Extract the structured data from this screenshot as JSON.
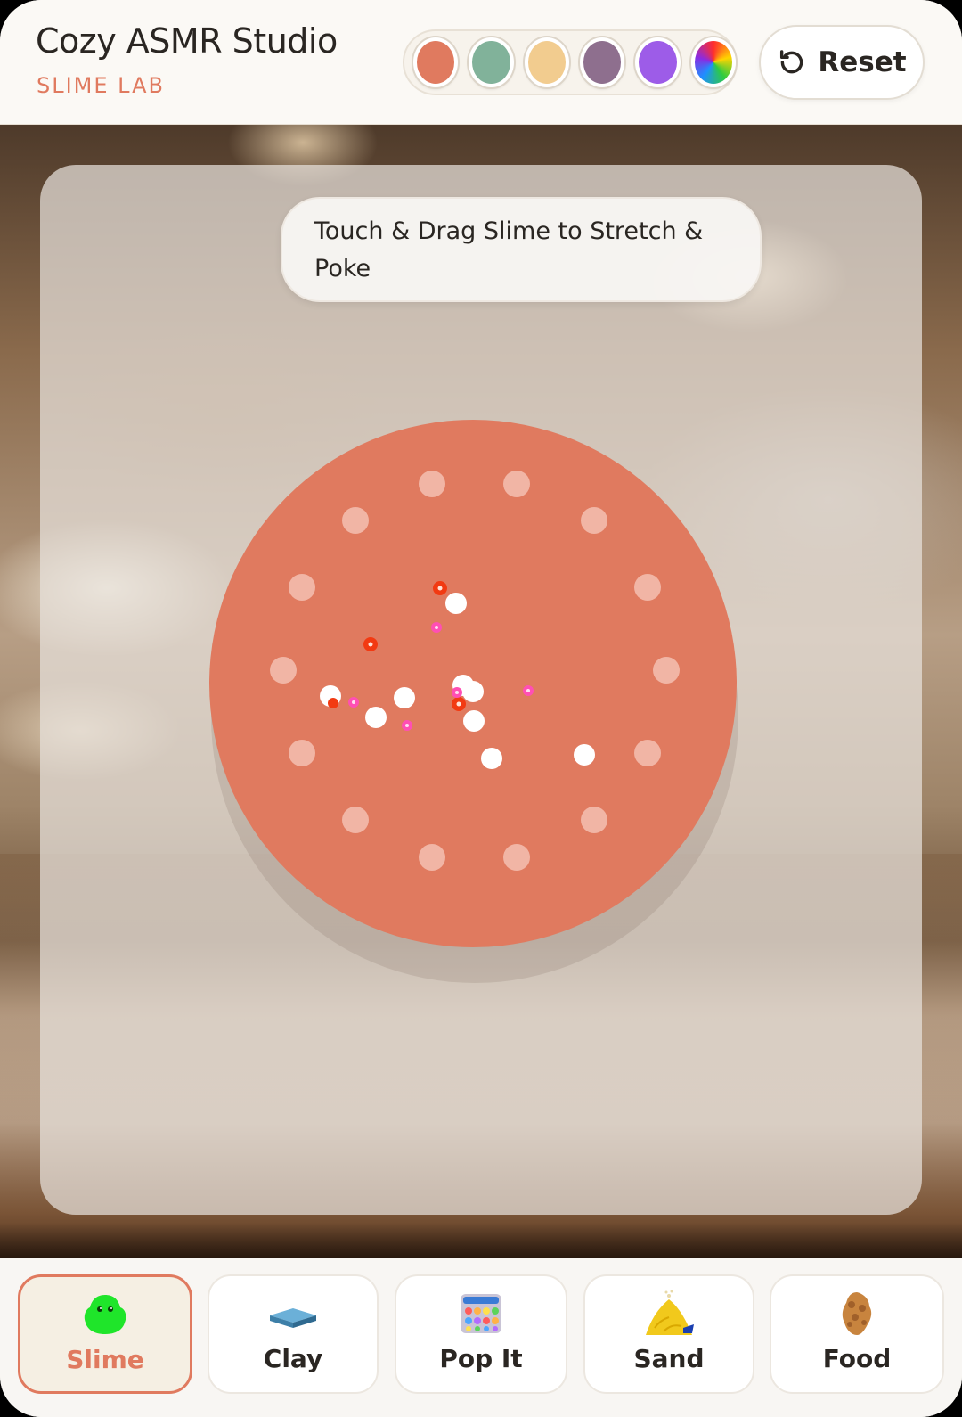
{
  "header": {
    "title": "Cozy ASMR Studio",
    "subtitle": "SLIME LAB",
    "reset_label": "Reset",
    "reset_icon": "rotate-ccw-icon"
  },
  "swatches": [
    {
      "name": "coral",
      "color": "#e07a5f",
      "selected": true
    },
    {
      "name": "sage",
      "color": "#81b29a",
      "selected": false
    },
    {
      "name": "sand",
      "color": "#f2cc8f",
      "selected": false
    },
    {
      "name": "mauve",
      "color": "#8e6f8e",
      "selected": false
    },
    {
      "name": "purple",
      "color": "#9d5ce8",
      "selected": false
    },
    {
      "name": "rainbow",
      "color": "conic-gradient",
      "selected": false
    }
  ],
  "canvas": {
    "hint": "Touch & Drag Slime to Stretch & Poke",
    "slime_color": "#e07a5f"
  },
  "tabs": [
    {
      "id": "slime",
      "label": "Slime",
      "icon": "green-slime-blob-icon",
      "active": true
    },
    {
      "id": "clay",
      "label": "Clay",
      "icon": "blue-clay-slab-icon",
      "active": false
    },
    {
      "id": "popit",
      "label": "Pop It",
      "icon": "pop-it-toy-icon",
      "active": false
    },
    {
      "id": "sand",
      "label": "Sand",
      "icon": "sand-pile-icon",
      "active": false
    },
    {
      "id": "food",
      "label": "Food",
      "icon": "fried-food-icon",
      "active": false
    }
  ],
  "theme": {
    "accent": "#e07a5f",
    "text": "#2a2622",
    "panel": "#fbf9f5"
  }
}
